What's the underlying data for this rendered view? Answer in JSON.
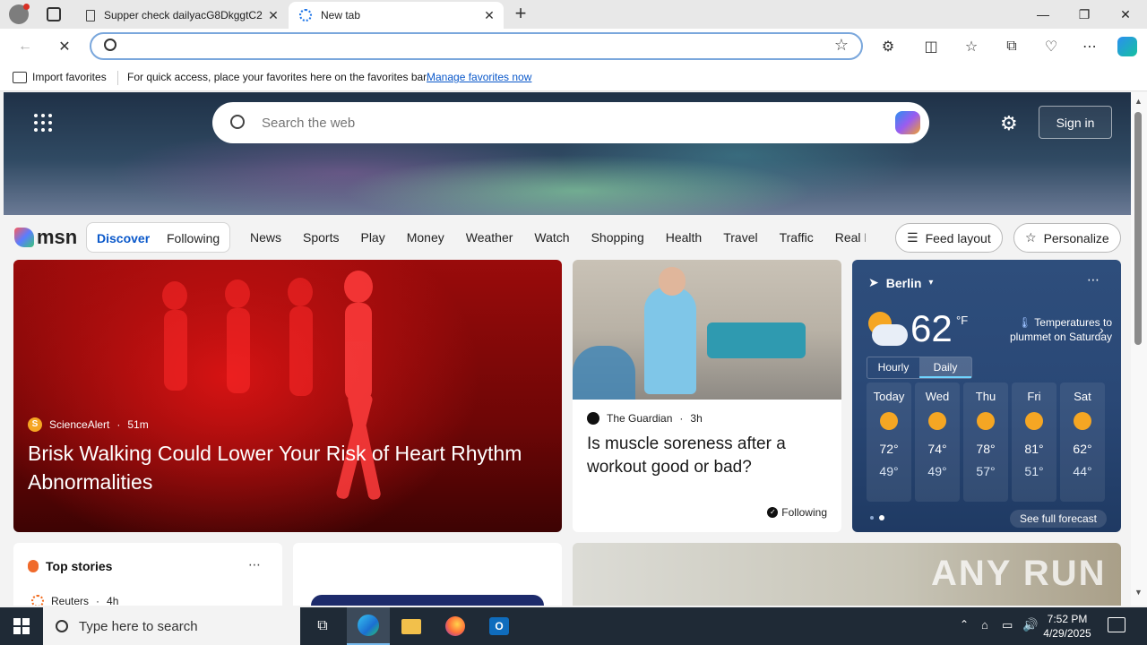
{
  "tabs": [
    {
      "title": "Supper check dailyacG8DkggtC2",
      "active": false
    },
    {
      "title": "New tab",
      "active": true
    }
  ],
  "address_bar": {
    "value": "",
    "placeholder": ""
  },
  "favorites_bar": {
    "import_label": "Import favorites",
    "message": "For quick access, place your favorites here on the favorites bar.",
    "manage_link": "Manage favorites now"
  },
  "hero": {
    "search_placeholder": "Search the web",
    "signin_label": "Sign in"
  },
  "msn": {
    "logo_text": "msn",
    "pill": {
      "discover": "Discover",
      "following": "Following"
    },
    "nav": [
      "News",
      "Sports",
      "Play",
      "Money",
      "Weather",
      "Watch",
      "Shopping",
      "Health",
      "Travel",
      "Traffic",
      "Real E"
    ],
    "feed_layout_label": "Feed layout",
    "personalize_label": "Personalize"
  },
  "main_card": {
    "source": "ScienceAlert",
    "age": "51m",
    "headline": "Brisk Walking Could Lower Your Risk of Heart Rhythm Abnormalities"
  },
  "card2": {
    "source": "The Guardian",
    "age": "3h",
    "headline": "Is muscle soreness after a workout good or bad?",
    "following_label": "Following"
  },
  "weather": {
    "city": "Berlin",
    "temp": "62",
    "unit": "°F",
    "alert": "Temperatures to plummet on Saturday",
    "toggle": {
      "hourly": "Hourly",
      "daily": "Daily"
    },
    "days": [
      {
        "name": "Today",
        "hi": "72°",
        "lo": "49°",
        "icon": "partly-cloudy-icon"
      },
      {
        "name": "Wed",
        "hi": "74°",
        "lo": "49°",
        "icon": "partly-cloudy-icon"
      },
      {
        "name": "Thu",
        "hi": "78°",
        "lo": "57°",
        "icon": "sunny-icon"
      },
      {
        "name": "Fri",
        "hi": "81°",
        "lo": "51°",
        "icon": "partly-cloudy-icon"
      },
      {
        "name": "Sat",
        "hi": "62°",
        "lo": "44°",
        "icon": "partly-cloudy-icon"
      }
    ],
    "see_full": "See full forecast"
  },
  "top_stories": {
    "title": "Top stories",
    "source": "Reuters",
    "age": "4h"
  },
  "card6": {
    "watermark": "ANY RUN"
  },
  "taskbar": {
    "search_placeholder": "Type here to search",
    "time": "7:52 PM",
    "date": "4/29/2025"
  },
  "colors": {
    "accent": "#0a58ca",
    "taskbar": "#1f2a36",
    "main_card": "#b50d0d",
    "weather_bg": "#2a4876"
  }
}
